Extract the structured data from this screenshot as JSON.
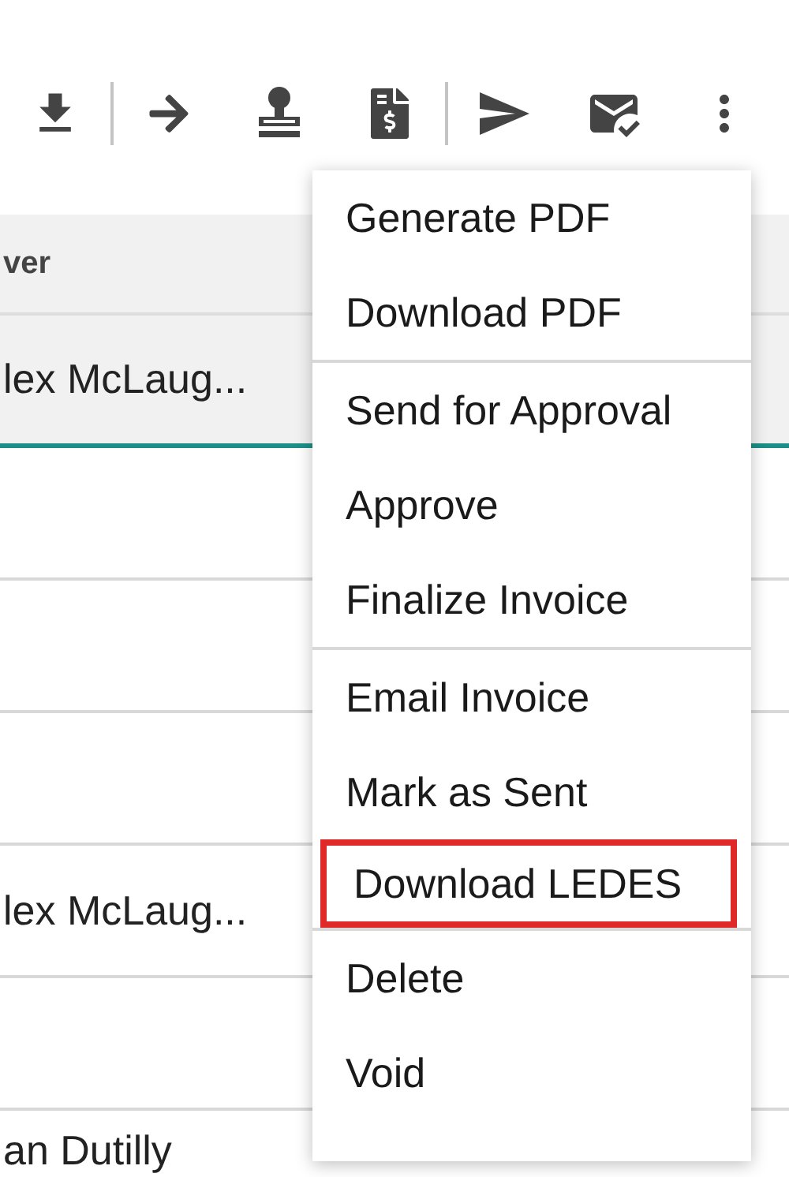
{
  "table": {
    "columns": [
      {
        "label": "ver"
      }
    ],
    "rows": [
      {
        "cells": [
          "lex McLaug..."
        ],
        "selected": true
      },
      {
        "cells": [
          ""
        ],
        "selected": false
      },
      {
        "cells": [
          ""
        ],
        "selected": false
      },
      {
        "cells": [
          ""
        ],
        "selected": false
      },
      {
        "cells": [
          "lex McLaug..."
        ],
        "selected": false
      },
      {
        "cells": [
          ""
        ],
        "selected": false
      },
      {
        "cells": [
          "an Dutilly"
        ],
        "selected": false
      }
    ]
  },
  "menu": {
    "groups": [
      [
        {
          "label": "Generate PDF",
          "highlighted": false
        },
        {
          "label": "Download PDF",
          "highlighted": false
        }
      ],
      [
        {
          "label": "Send for Approval",
          "highlighted": false
        },
        {
          "label": "Approve",
          "highlighted": false
        },
        {
          "label": "Finalize Invoice",
          "highlighted": false
        }
      ],
      [
        {
          "label": "Email Invoice",
          "highlighted": false
        },
        {
          "label": "Mark as Sent",
          "highlighted": false
        },
        {
          "label": "Download LEDES",
          "highlighted": true
        }
      ],
      [
        {
          "label": "Delete",
          "highlighted": false
        },
        {
          "label": "Void",
          "highlighted": false
        }
      ]
    ]
  }
}
